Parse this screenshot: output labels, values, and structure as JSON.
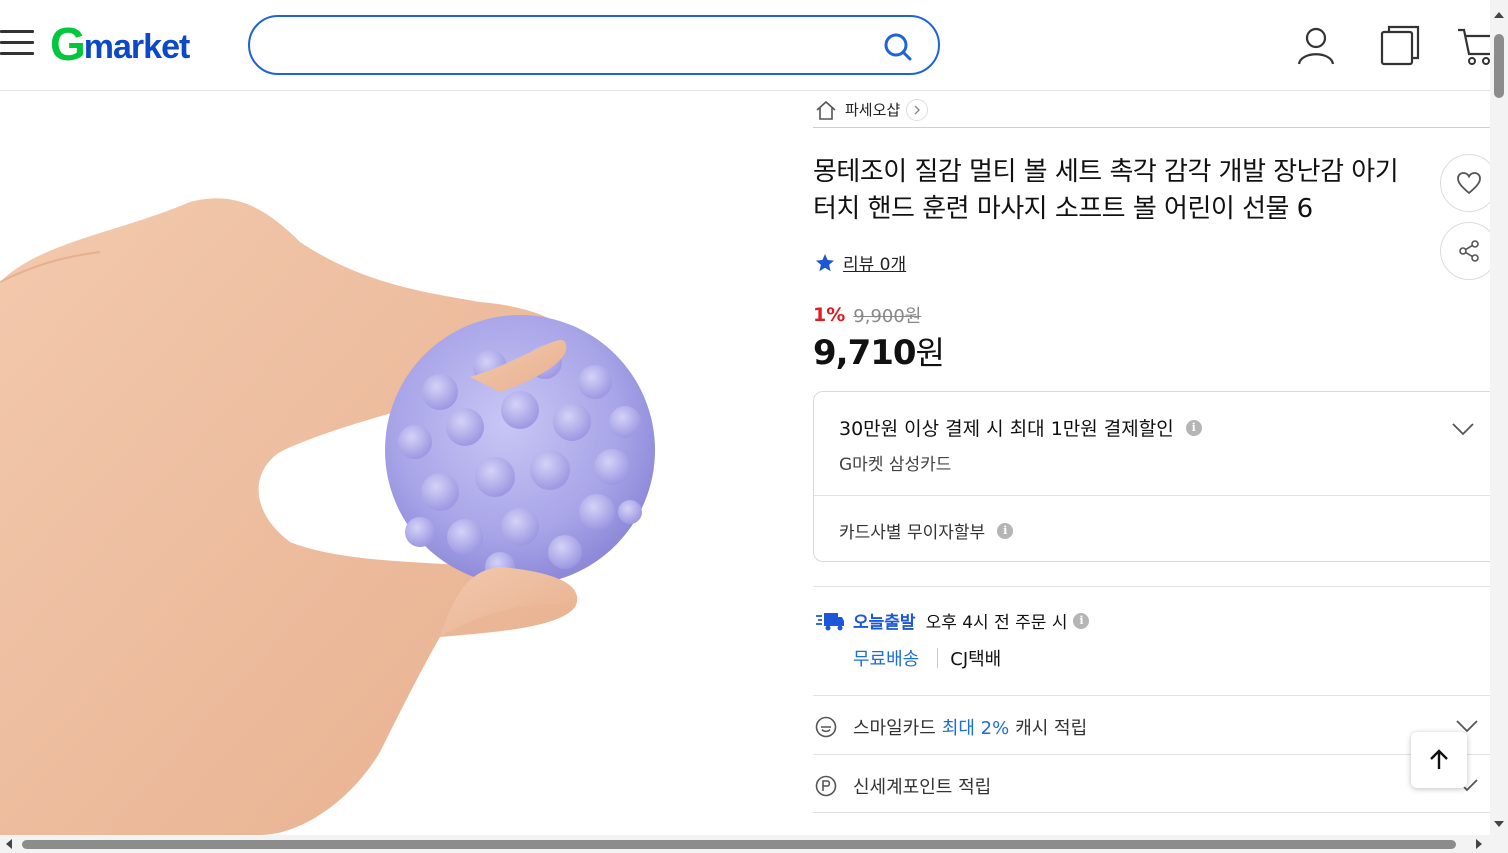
{
  "header": {
    "logo_g": "G",
    "logo_rest": "market",
    "search_placeholder": ""
  },
  "breadcrumb": {
    "shop_name": "파세오샵"
  },
  "product": {
    "title": "몽테조이 질감 멀티 볼 세트 촉각 감각 개발 장난감 아기 터치 핸드 훈련 마사지 소프트 볼 어린이 선물 6",
    "review_text": "리뷰 0개",
    "discount_pct": "1%",
    "original_price": "9,900원",
    "price_number": "9,710",
    "price_unit": "원"
  },
  "card_offer": {
    "main": "30만원 이상 결제 시 최대 1만원 결제할인",
    "sub": "G마켓 삼성카드",
    "installment": "카드사별 무이자할부"
  },
  "shipping": {
    "badge": "오늘출발",
    "condition": "오후 4시 전 주문 시",
    "free": "무료배송",
    "carrier": "CJ택배"
  },
  "benefits": {
    "smile_prefix": "스마일카드",
    "smile_highlight": "최대 2%",
    "smile_suffix": "캐시 적립",
    "ssg": "신세계포인트 적립"
  },
  "colors": {
    "brand_green": "#00c73c",
    "brand_blue": "#0b49c7",
    "search_border": "#1e64d8",
    "discount_red": "#e01b24",
    "link_blue": "#1c6ed8"
  }
}
